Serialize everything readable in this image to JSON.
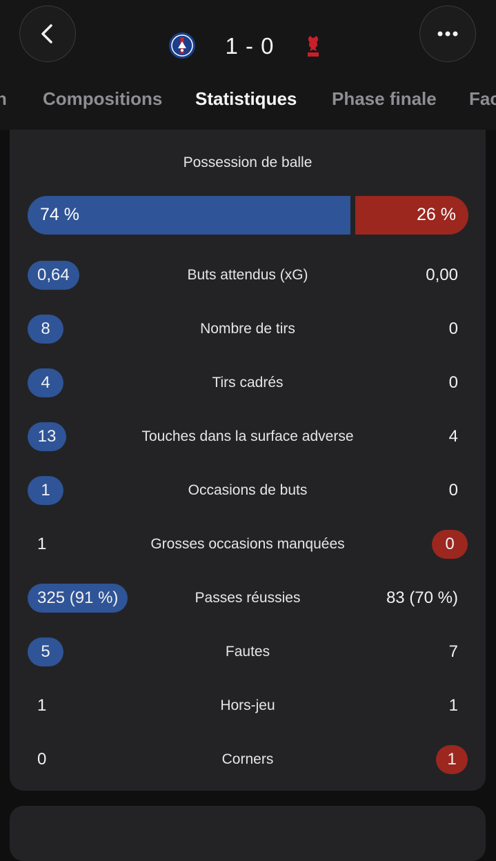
{
  "header": {
    "score": "1 - 0",
    "home_crest": "psg-crest",
    "away_crest": "liverpool-crest"
  },
  "tabs": [
    {
      "label": "h",
      "active": false
    },
    {
      "label": "Compositions",
      "active": false
    },
    {
      "label": "Statistiques",
      "active": true
    },
    {
      "label": "Phase finale",
      "active": false
    },
    {
      "label": "Fac",
      "active": false
    }
  ],
  "possession": {
    "title": "Possession de balle",
    "home_value": 74,
    "away_value": 26,
    "home_label": "74 %",
    "away_label": "26 %"
  },
  "stats": [
    {
      "label": "Buts attendus (xG)",
      "home": "0,64",
      "away": "0,00",
      "highlight": "home"
    },
    {
      "label": "Nombre de tirs",
      "home": "8",
      "away": "0",
      "highlight": "home"
    },
    {
      "label": "Tirs cadrés",
      "home": "4",
      "away": "0",
      "highlight": "home"
    },
    {
      "label": "Touches dans la surface adverse",
      "home": "13",
      "away": "4",
      "highlight": "home"
    },
    {
      "label": "Occasions de buts",
      "home": "1",
      "away": "0",
      "highlight": "home"
    },
    {
      "label": "Grosses occasions manquées",
      "home": "1",
      "away": "0",
      "highlight": "away"
    },
    {
      "label": "Passes réussies",
      "home": "325 (91 %)",
      "away": "83 (70 %)",
      "highlight": "home"
    },
    {
      "label": "Fautes",
      "home": "5",
      "away": "7",
      "highlight": "home"
    },
    {
      "label": "Hors-jeu",
      "home": "1",
      "away": "1",
      "highlight": "none"
    },
    {
      "label": "Corners",
      "home": "0",
      "away": "1",
      "highlight": "away"
    }
  ],
  "colors": {
    "home": "#2f5497",
    "away": "#9b271f",
    "background": "#0f0f10",
    "card": "#232325"
  }
}
